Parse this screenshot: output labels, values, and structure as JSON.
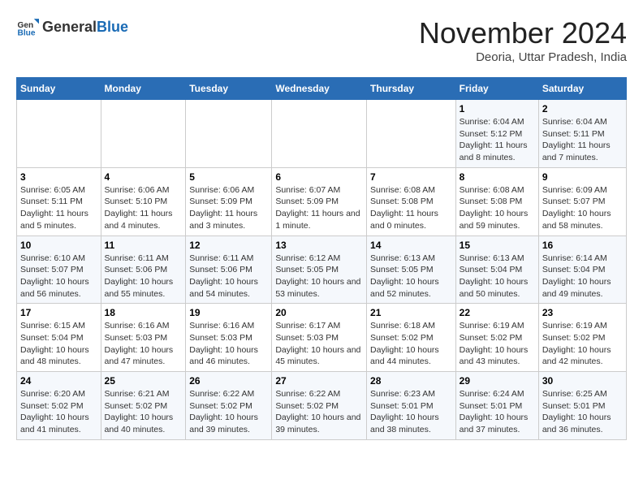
{
  "logo": {
    "general": "General",
    "blue": "Blue"
  },
  "title": "November 2024",
  "subtitle": "Deoria, Uttar Pradesh, India",
  "headers": [
    "Sunday",
    "Monday",
    "Tuesday",
    "Wednesday",
    "Thursday",
    "Friday",
    "Saturday"
  ],
  "weeks": [
    [
      {
        "num": "",
        "info": ""
      },
      {
        "num": "",
        "info": ""
      },
      {
        "num": "",
        "info": ""
      },
      {
        "num": "",
        "info": ""
      },
      {
        "num": "",
        "info": ""
      },
      {
        "num": "1",
        "info": "Sunrise: 6:04 AM\nSunset: 5:12 PM\nDaylight: 11 hours and 8 minutes."
      },
      {
        "num": "2",
        "info": "Sunrise: 6:04 AM\nSunset: 5:11 PM\nDaylight: 11 hours and 7 minutes."
      }
    ],
    [
      {
        "num": "3",
        "info": "Sunrise: 6:05 AM\nSunset: 5:11 PM\nDaylight: 11 hours and 5 minutes."
      },
      {
        "num": "4",
        "info": "Sunrise: 6:06 AM\nSunset: 5:10 PM\nDaylight: 11 hours and 4 minutes."
      },
      {
        "num": "5",
        "info": "Sunrise: 6:06 AM\nSunset: 5:09 PM\nDaylight: 11 hours and 3 minutes."
      },
      {
        "num": "6",
        "info": "Sunrise: 6:07 AM\nSunset: 5:09 PM\nDaylight: 11 hours and 1 minute."
      },
      {
        "num": "7",
        "info": "Sunrise: 6:08 AM\nSunset: 5:08 PM\nDaylight: 11 hours and 0 minutes."
      },
      {
        "num": "8",
        "info": "Sunrise: 6:08 AM\nSunset: 5:08 PM\nDaylight: 10 hours and 59 minutes."
      },
      {
        "num": "9",
        "info": "Sunrise: 6:09 AM\nSunset: 5:07 PM\nDaylight: 10 hours and 58 minutes."
      }
    ],
    [
      {
        "num": "10",
        "info": "Sunrise: 6:10 AM\nSunset: 5:07 PM\nDaylight: 10 hours and 56 minutes."
      },
      {
        "num": "11",
        "info": "Sunrise: 6:11 AM\nSunset: 5:06 PM\nDaylight: 10 hours and 55 minutes."
      },
      {
        "num": "12",
        "info": "Sunrise: 6:11 AM\nSunset: 5:06 PM\nDaylight: 10 hours and 54 minutes."
      },
      {
        "num": "13",
        "info": "Sunrise: 6:12 AM\nSunset: 5:05 PM\nDaylight: 10 hours and 53 minutes."
      },
      {
        "num": "14",
        "info": "Sunrise: 6:13 AM\nSunset: 5:05 PM\nDaylight: 10 hours and 52 minutes."
      },
      {
        "num": "15",
        "info": "Sunrise: 6:13 AM\nSunset: 5:04 PM\nDaylight: 10 hours and 50 minutes."
      },
      {
        "num": "16",
        "info": "Sunrise: 6:14 AM\nSunset: 5:04 PM\nDaylight: 10 hours and 49 minutes."
      }
    ],
    [
      {
        "num": "17",
        "info": "Sunrise: 6:15 AM\nSunset: 5:04 PM\nDaylight: 10 hours and 48 minutes."
      },
      {
        "num": "18",
        "info": "Sunrise: 6:16 AM\nSunset: 5:03 PM\nDaylight: 10 hours and 47 minutes."
      },
      {
        "num": "19",
        "info": "Sunrise: 6:16 AM\nSunset: 5:03 PM\nDaylight: 10 hours and 46 minutes."
      },
      {
        "num": "20",
        "info": "Sunrise: 6:17 AM\nSunset: 5:03 PM\nDaylight: 10 hours and 45 minutes."
      },
      {
        "num": "21",
        "info": "Sunrise: 6:18 AM\nSunset: 5:02 PM\nDaylight: 10 hours and 44 minutes."
      },
      {
        "num": "22",
        "info": "Sunrise: 6:19 AM\nSunset: 5:02 PM\nDaylight: 10 hours and 43 minutes."
      },
      {
        "num": "23",
        "info": "Sunrise: 6:19 AM\nSunset: 5:02 PM\nDaylight: 10 hours and 42 minutes."
      }
    ],
    [
      {
        "num": "24",
        "info": "Sunrise: 6:20 AM\nSunset: 5:02 PM\nDaylight: 10 hours and 41 minutes."
      },
      {
        "num": "25",
        "info": "Sunrise: 6:21 AM\nSunset: 5:02 PM\nDaylight: 10 hours and 40 minutes."
      },
      {
        "num": "26",
        "info": "Sunrise: 6:22 AM\nSunset: 5:02 PM\nDaylight: 10 hours and 39 minutes."
      },
      {
        "num": "27",
        "info": "Sunrise: 6:22 AM\nSunset: 5:02 PM\nDaylight: 10 hours and 39 minutes."
      },
      {
        "num": "28",
        "info": "Sunrise: 6:23 AM\nSunset: 5:01 PM\nDaylight: 10 hours and 38 minutes."
      },
      {
        "num": "29",
        "info": "Sunrise: 6:24 AM\nSunset: 5:01 PM\nDaylight: 10 hours and 37 minutes."
      },
      {
        "num": "30",
        "info": "Sunrise: 6:25 AM\nSunset: 5:01 PM\nDaylight: 10 hours and 36 minutes."
      }
    ]
  ]
}
